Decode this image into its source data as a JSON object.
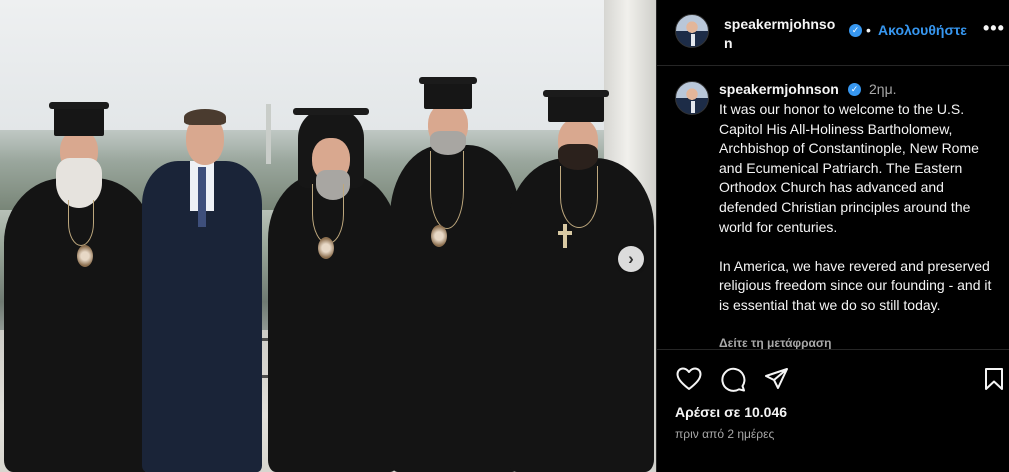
{
  "post": {
    "photo_alt": "",
    "next_icon": "chevron-right-icon"
  },
  "header": {
    "username": "speakermjohnson",
    "separator": "•",
    "follow_label": "Ακολουθήστε",
    "more_label": "•••"
  },
  "caption": {
    "username": "speakermjohnson",
    "time": "2ημ.",
    "paragraphs": [
      "It was our honor to welcome to the U.S. Capitol His All-Holiness Bartholomew, Archbishop of Constantinople, New Rome and Ecumenical Patriarch. The Eastern Orthodox Church has advanced and defended Christian principles around the world for centuries.",
      "In America, we have revered and preserved religious freedom since our founding - and it is essential that we do so still today."
    ],
    "translate_label": "Δείτε τη μετάφραση"
  },
  "actions": {
    "likes_label": "Αρέσει σε 10.046",
    "date_label": "πριν από 2 ημέρες"
  },
  "colors": {
    "background": "#000000",
    "accent": "#3797f0",
    "text": "#f5f5f5",
    "muted": "#a8a8a8",
    "divider": "#262626"
  }
}
